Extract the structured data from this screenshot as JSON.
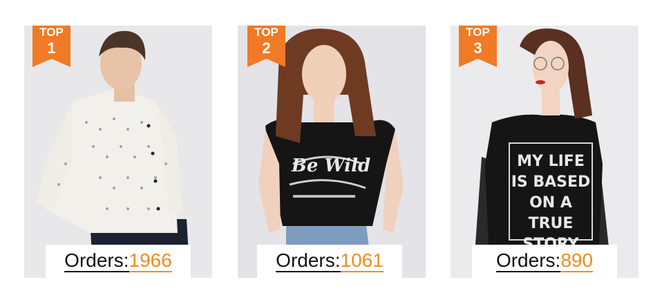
{
  "products": [
    {
      "rank_label": "TOP",
      "rank": "1",
      "orders_label": "Orders:",
      "orders_count": "1966"
    },
    {
      "rank_label": "TOP",
      "rank": "2",
      "orders_label": "Orders:",
      "orders_count": "1061",
      "shirt_print": "Be Wild"
    },
    {
      "rank_label": "TOP",
      "rank": "3",
      "orders_label": "Orders:",
      "orders_count": "890",
      "shirt_lines": [
        "MY LIFE",
        "IS BASED",
        "ON A TRUE",
        "STORY"
      ]
    }
  ],
  "colors": {
    "badge": "#f07a25",
    "count": "#f08c22",
    "card_bg": "#e9e9eb"
  },
  "icons": {
    "badge": "ribbon-badge-icon"
  }
}
